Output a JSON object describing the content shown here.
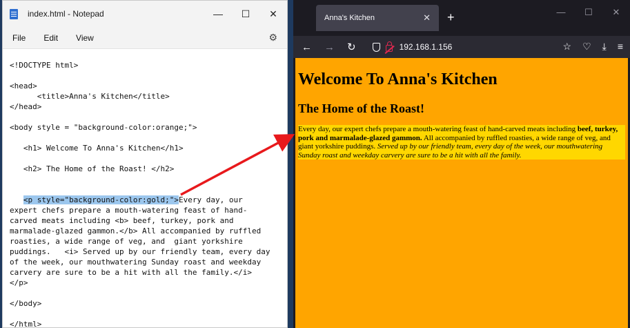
{
  "notepad": {
    "title": "index.html - Notepad",
    "controls": {
      "minimize": "—",
      "maximize": "☐",
      "close": "✕"
    },
    "menu": [
      "File",
      "Edit",
      "View"
    ],
    "settings_icon": "gear-icon",
    "lines": [
      "<!DOCTYPE html>",
      "",
      "<head>",
      "      <title>Anna's Kitchen</title>",
      "</head>",
      "",
      "<body style = \"background-color:orange;\">",
      "",
      "   <h1> Welcome To Anna's Kitchen</h1>",
      "",
      "   <h2> The Home of the Roast! </h2>",
      "",
      "",
      "expert chefs prepare a mouth-watering feast of hand-",
      "carved meats including <b> beef, turkey, pork and",
      "marmalade-glazed gammon.</b> All accompanied by ruffled",
      "roasties, a wide range of veg, and  giant yorkshire",
      "puddings.   <i> Served up by our friendly team, every day",
      "of the week, our mouthwatering Sunday roast and weekday",
      "carvery are sure to be a hit with all the family.</i>",
      "</p>",
      "",
      "</body>",
      "",
      "</html>"
    ],
    "p_line_prefix": "   ",
    "p_line_highlight": "<p style=\"background-color:gold;\">",
    "p_line_rest": "Every day, our"
  },
  "browser": {
    "tab_title": "Anna's Kitchen",
    "tab_close": "✕",
    "new_tab": "+",
    "window_controls": {
      "minimize": "—",
      "maximize": "☐",
      "close": "✕"
    },
    "nav": {
      "back": "←",
      "forward": "→",
      "reload": "↻"
    },
    "url": "192.168.1.156",
    "toolbar_icons": {
      "bookmark": "☆",
      "pocket": "♡",
      "download": "⤓",
      "menu": "≡"
    },
    "page": {
      "h1": "Welcome To Anna's Kitchen",
      "h2": "The Home of the Roast!",
      "p_text1": "Every day, our expert chefs prepare a mouth-watering feast of hand-carved meats including ",
      "p_bold": "beef, turkey, pork and marmalade-glazed gammon.",
      "p_text2": " All accompanied by ruffled roasties, a wide range of veg, and giant yorkshire puddings. ",
      "p_italic": "Served up by our friendly team, every day of the week, our mouthwatering Sunday roast and weekday carvery are sure to be a hit with all the family."
    },
    "colors": {
      "background": "#ffa500",
      "paragraph": "#ffd700"
    }
  },
  "annotation": {
    "arrow_color": "#e8191c"
  }
}
